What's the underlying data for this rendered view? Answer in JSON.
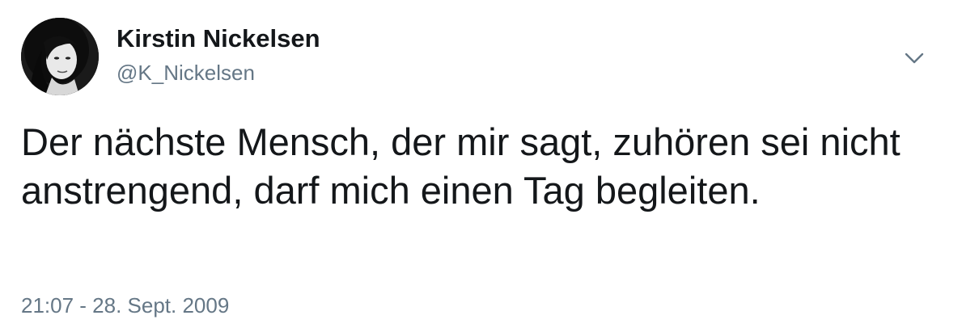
{
  "tweet": {
    "author": {
      "name": "Kirstin Nickelsen",
      "handle": "@K_Nickelsen",
      "avatar": "profile-photo"
    },
    "text": "Der nächste Mensch, der mir sagt, zuhören sei nicht anstrengend, darf mich einen Tag begleiten.",
    "timestamp": "21:07 - 28. Sept. 2009",
    "menu_icon": "chevron-down-icon"
  },
  "colors": {
    "text_primary": "#14171a",
    "text_secondary": "#657786",
    "background": "#ffffff"
  }
}
